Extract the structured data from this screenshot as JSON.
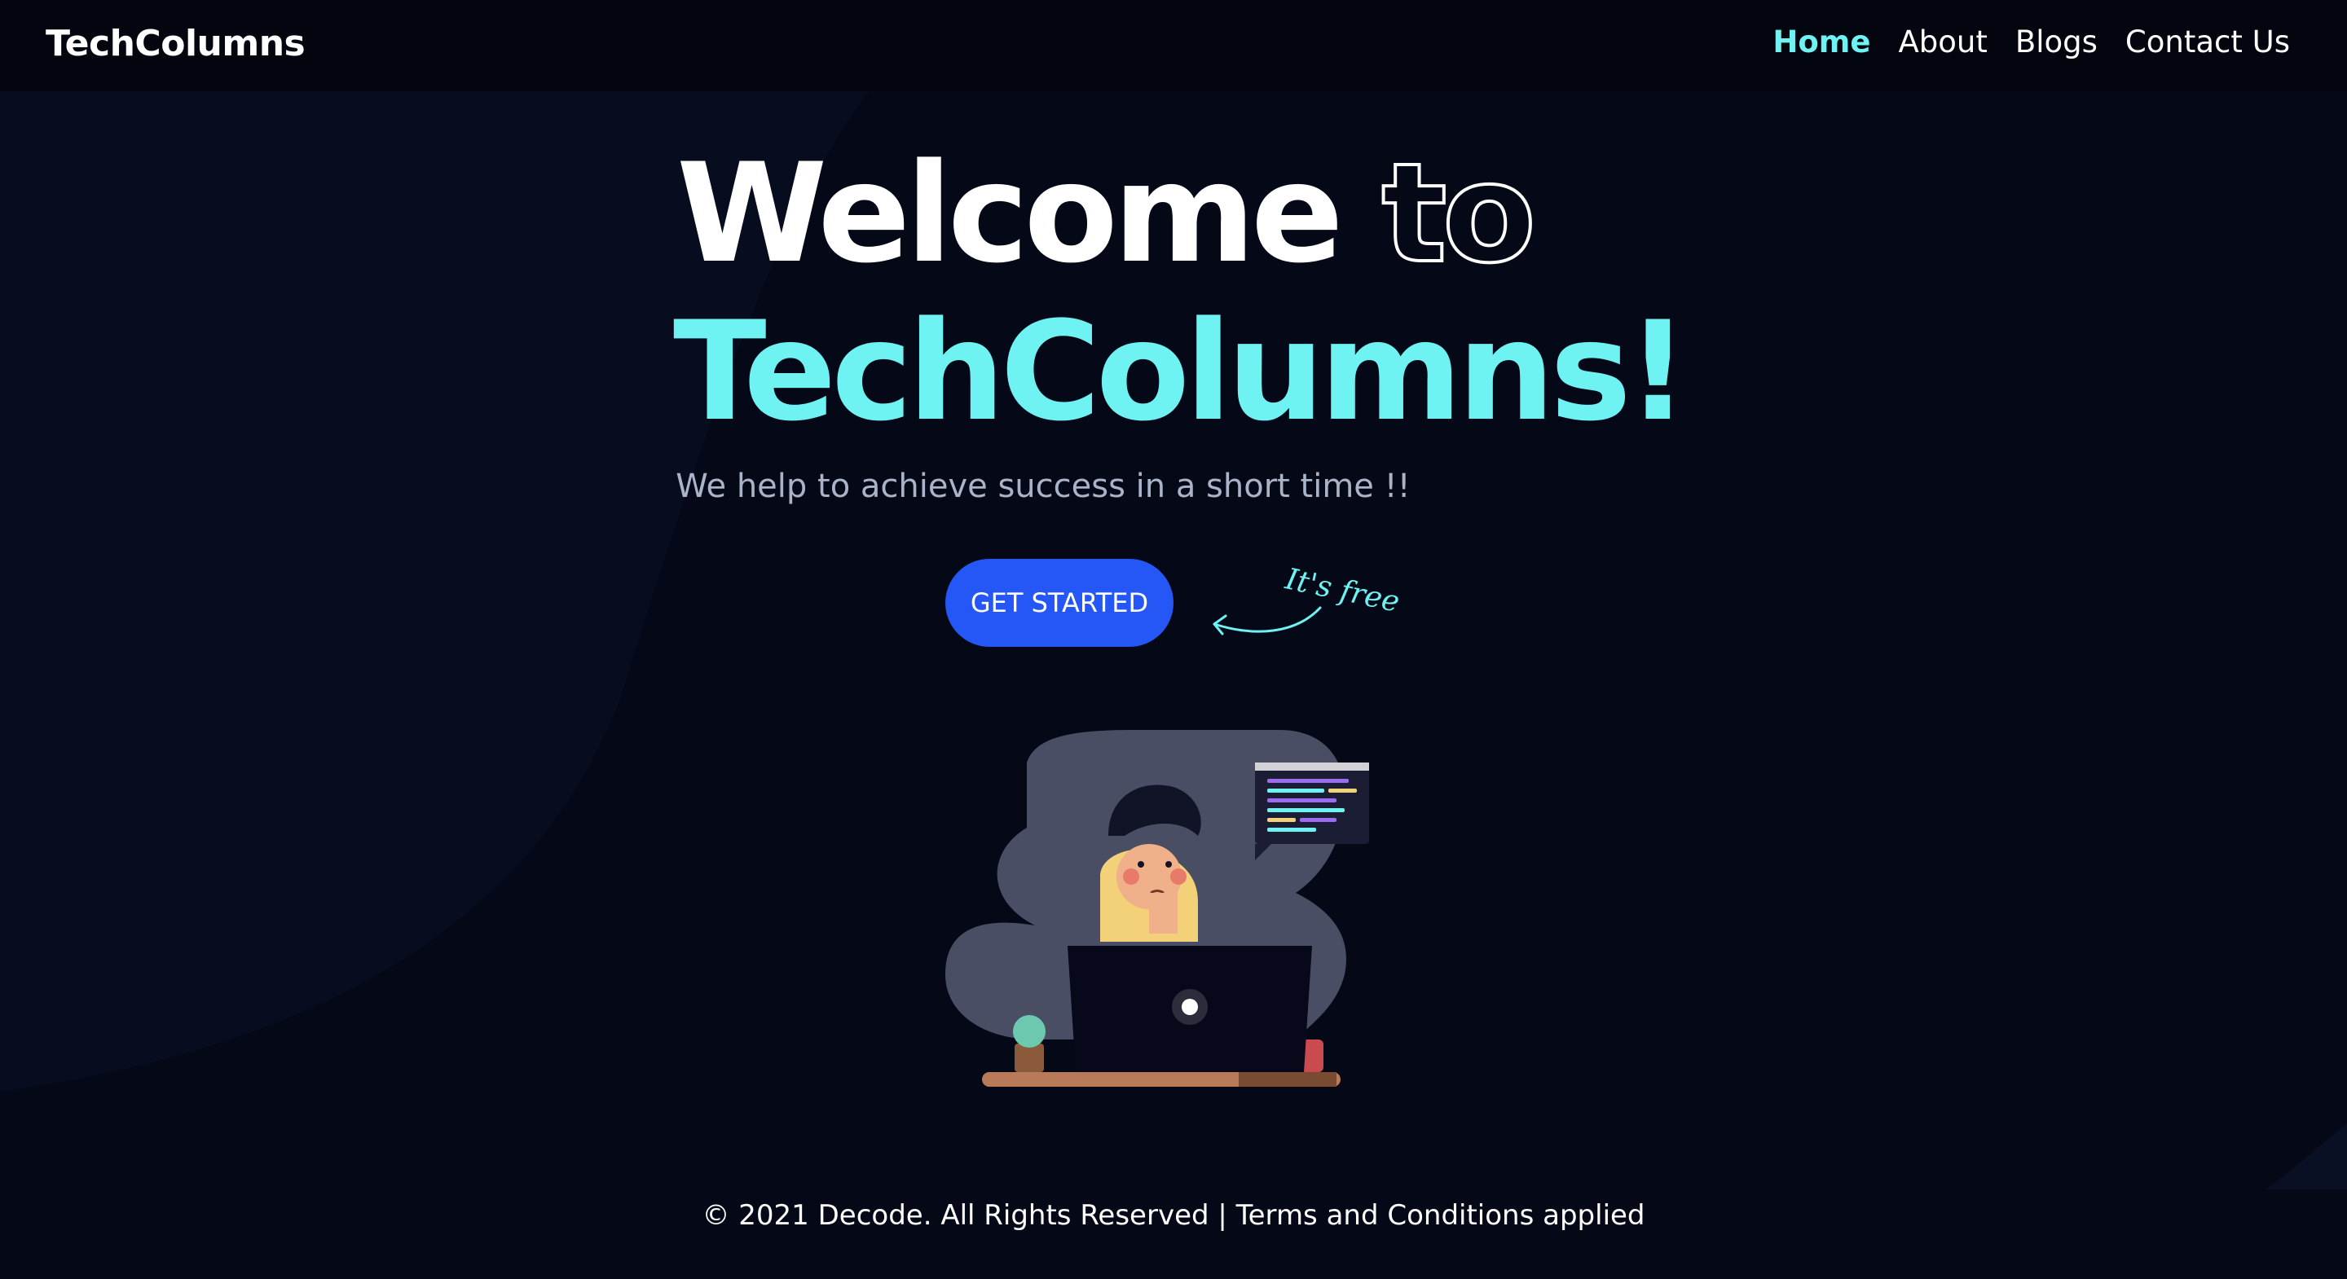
{
  "nav": {
    "brand": "TechColumns",
    "links": [
      "Home",
      "About",
      "Blogs",
      "Contact Us"
    ],
    "active": "Home"
  },
  "hero": {
    "word_welcome": "Welcome",
    "word_to": "to",
    "headline2": "TechColumns!",
    "tagline": "We help to achieve success in a short time !!",
    "cta_label": "GET STARTED",
    "note": "It's free"
  },
  "footer": {
    "text": "© 2021 Decode. All Rights Reserved | Terms and Conditions applied"
  },
  "colors": {
    "accent": "#6ff2f2",
    "button": "#2457f5",
    "background": "#050917",
    "navbar": "#03060f"
  },
  "icons": [
    "arrow-icon",
    "developer-illustration"
  ]
}
